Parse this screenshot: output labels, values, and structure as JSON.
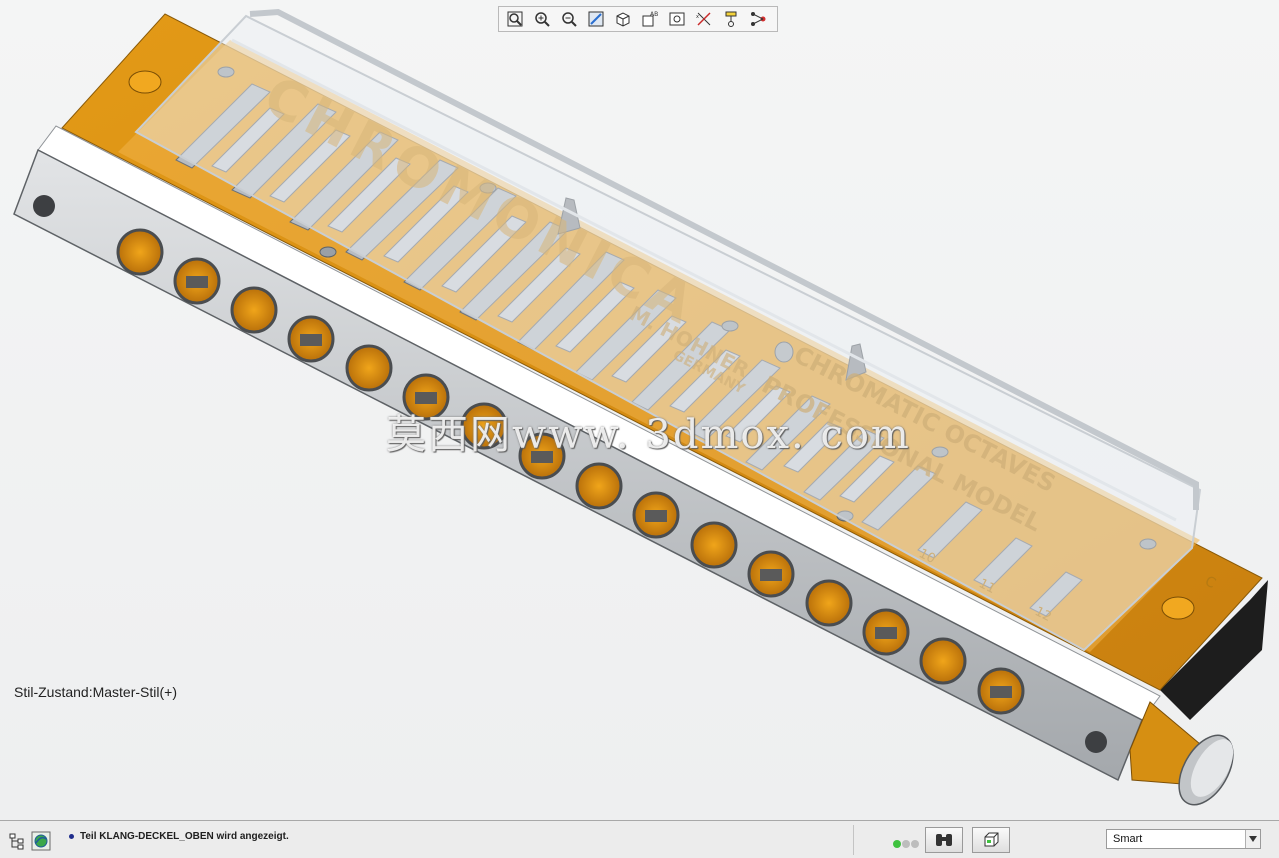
{
  "viewport": {
    "style_state": "Stil-Zustand:Master-Stil(+)",
    "watermark": "莫西网www. 3dmox. com"
  },
  "toolbar": {
    "buttons": [
      {
        "name": "refit-icon"
      },
      {
        "name": "zoom-in-icon"
      },
      {
        "name": "zoom-out-icon"
      },
      {
        "name": "repaint-icon"
      },
      {
        "name": "display-style-icon"
      },
      {
        "name": "saved-views-icon"
      },
      {
        "name": "view-manager-icon"
      },
      {
        "name": "datum-display-icon"
      },
      {
        "name": "annotation-display-icon"
      },
      {
        "name": "spin-center-icon"
      }
    ]
  },
  "model": {
    "cover_text_1": "CHROMONICA",
    "cover_text_2": "CHROMATIC OCTAVES",
    "cover_text_3": "PROFESSIONAL MODEL",
    "cover_text_4": "M. HOHNER",
    "cover_text_5": "GERMANY",
    "key_letter": "C",
    "channel_numbers": [
      "10",
      "11",
      "12"
    ],
    "hole_count": 16,
    "colors": {
      "wood": "#e8a21a",
      "metal": "#c8cacc",
      "reed": "#a9aeb4",
      "cover": "rgba(236,240,244,0.55)"
    }
  },
  "status": {
    "message": "Teil KLANG-DECKEL_OBEN wird angezeigt.",
    "filter_value": "Smart",
    "light_colors": [
      "#3fc23f",
      "#bdbdbd",
      "#bdbdbd"
    ]
  }
}
